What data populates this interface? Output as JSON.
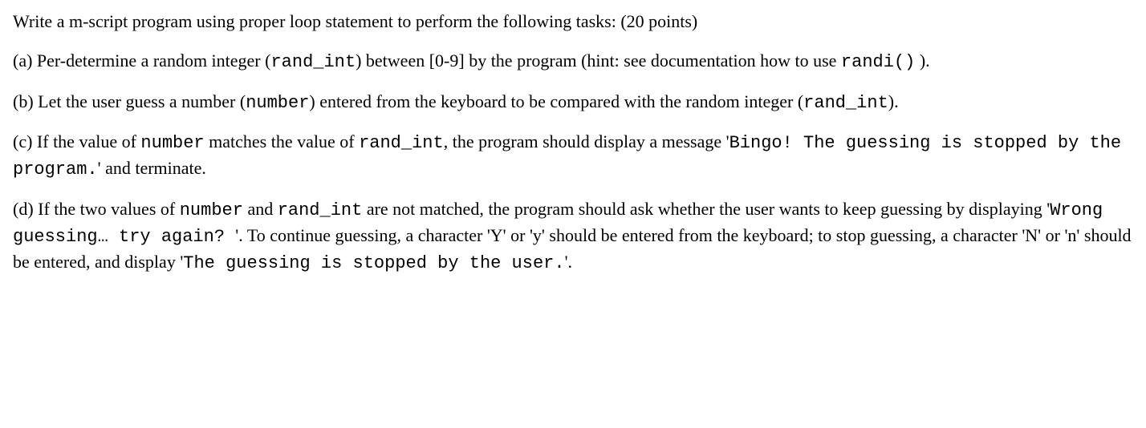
{
  "intro": {
    "text": "Write a m-script program using proper loop statement to perform the following tasks: (20 points)"
  },
  "part_a": {
    "t1": "(a) Per-determine a random integer (",
    "code1": "rand_int",
    "t2": ") between [0-9] by the program (hint: see documentation how to use ",
    "code2": "randi()",
    "t3": " )."
  },
  "part_b": {
    "t1": "(b) Let the user guess a number (",
    "code1": "number",
    "t2": ") entered from the keyboard to be compared with the random integer (",
    "code2": "rand_int",
    "t3": ")."
  },
  "part_c": {
    "t1": "(c) If the value of ",
    "code1": "number",
    "t2": " matches the value of ",
    "code2": "rand_int",
    "t3": ", the program should display a message '",
    "code3": "Bingo! The guessing is stopped by the program.",
    "t4": "' and terminate."
  },
  "part_d": {
    "t1": "(d) If the two values of ",
    "code1": "number",
    "t2": " and ",
    "code2": "rand_int",
    "t3": " are not matched, the program should ask whether the user wants to keep guessing by displaying '",
    "code3": "Wrong guessing… try again? ",
    "t4": "'. To continue guessing, a character 'Y' or 'y' should be entered from the keyboard; to stop guessing, a character 'N' or 'n' should be entered, and display '",
    "code4": "The guessing is stopped by the user.",
    "t5": "'."
  }
}
